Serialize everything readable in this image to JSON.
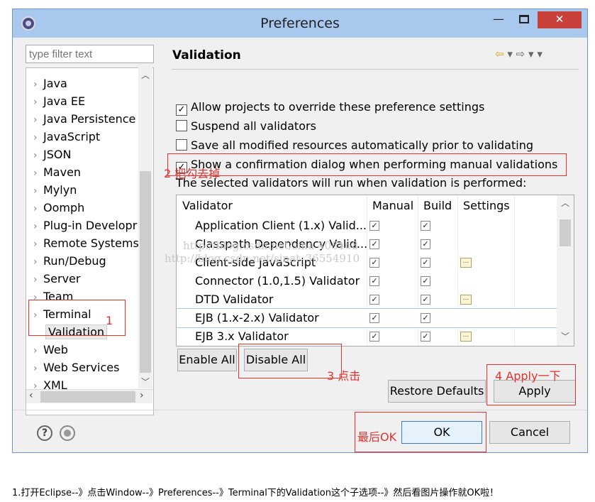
{
  "window": {
    "title": "Preferences",
    "minimize_glyph": "—",
    "close_glyph": "✕"
  },
  "sidebar": {
    "filter_placeholder": "type filter text",
    "items": [
      {
        "label": "Java"
      },
      {
        "label": "Java EE"
      },
      {
        "label": "Java Persistence"
      },
      {
        "label": "JavaScript"
      },
      {
        "label": "JSON"
      },
      {
        "label": "Maven"
      },
      {
        "label": "Mylyn"
      },
      {
        "label": "Oomph"
      },
      {
        "label": "Plug-in Developr"
      },
      {
        "label": "Remote Systems"
      },
      {
        "label": "Run/Debug"
      },
      {
        "label": "Server"
      },
      {
        "label": "Team"
      },
      {
        "label": "Terminal"
      },
      {
        "label": "Validation",
        "selected": true
      },
      {
        "label": "Web"
      },
      {
        "label": "Web Services"
      },
      {
        "label": "XML"
      }
    ]
  },
  "panel": {
    "title": "Validation",
    "options": [
      {
        "label": "Allow projects to override these preference settings",
        "checked": true
      },
      {
        "label": "Suspend all validators",
        "checked": false
      },
      {
        "label": "Save all modified resources automatically prior to validating",
        "checked": false
      },
      {
        "label": "Show a confirmation dialog when performing manual validations",
        "checked": true
      }
    ],
    "validators_intro": "The selected validators will run when validation is performed:",
    "table": {
      "headers": [
        "Validator",
        "Manual",
        "Build",
        "Settings"
      ],
      "rows": [
        {
          "name": "Application Client (1.x) Valid...",
          "manual": true,
          "build": true,
          "settings": false
        },
        {
          "name": "Classpath Dependency Valid...",
          "manual": true,
          "build": true,
          "settings": false
        },
        {
          "name": "Client-side JavaScript",
          "manual": true,
          "build": true,
          "settings": true
        },
        {
          "name": "Connector (1.0,1.5) Validator",
          "manual": true,
          "build": true,
          "settings": false
        },
        {
          "name": "DTD Validator",
          "manual": true,
          "build": true,
          "settings": true
        },
        {
          "name": "EJB (1.x-2.x) Validator",
          "manual": true,
          "build": true,
          "settings": false
        },
        {
          "name": "EJB 3.x Validator",
          "manual": true,
          "build": true,
          "settings": true
        }
      ]
    },
    "buttons": {
      "enable_all": "Enable All",
      "disable_all": "Disable All",
      "restore_defaults": "Restore Defaults",
      "apply": "Apply"
    }
  },
  "footer": {
    "ok": "OK",
    "cancel": "Cancel"
  },
  "annotations": {
    "step1": "1",
    "step2": "2 把勾去掉",
    "step3": "3 点击",
    "step4": "4 Apply一下",
    "final": "最后OK",
    "color": "#e5322d"
  },
  "watermark": {
    "line1": "http://blog.csdn.net/sina 408168",
    "line2": "http://blog.csdn.net/sinat_36554910"
  },
  "caption": "1.打开Eclipse--》点击Window--》Preferences--》Terminal下的Validation这个子选项--》然后看图片操作就OK啦！"
}
